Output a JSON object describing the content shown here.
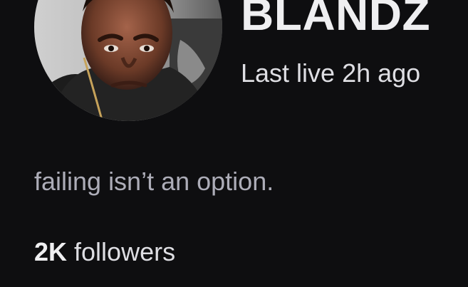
{
  "channel": {
    "name": "BLANDZ",
    "status": "Last live 2h ago",
    "avatar_icon": "profile-photo"
  },
  "about": {
    "bio": "failing isn’t an option."
  },
  "stats": {
    "followers_count": "2K",
    "followers_label": " followers"
  },
  "colors": {
    "background": "#0e0e10",
    "primary_text": "#efeff1",
    "secondary_text": "#adadb8"
  }
}
